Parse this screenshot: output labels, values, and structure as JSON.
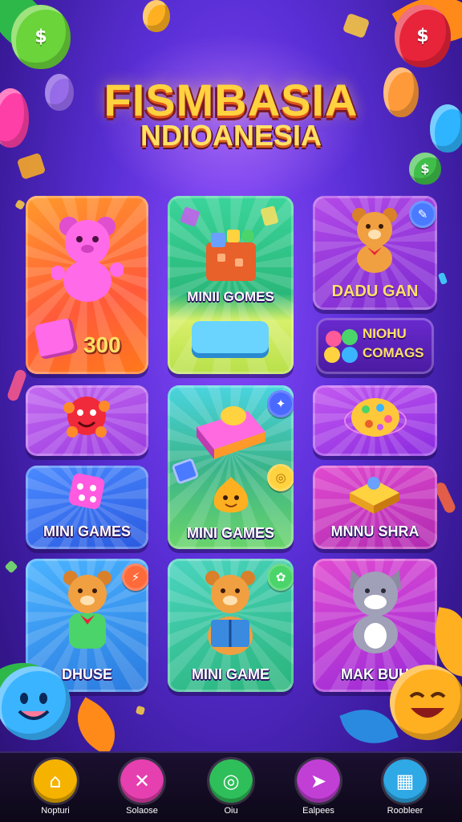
{
  "header": {
    "title_line1": "FISMBASIA",
    "title_line2": "NDIOANESIA"
  },
  "decor": {
    "balloon_left_glyph": "$",
    "balloon_right_glyph": "$",
    "balloon_small_glyph": "$"
  },
  "cards": {
    "bear_card": {
      "counter": "300",
      "icon": "pink-bear-icon"
    },
    "mini_box_card": {
      "label": "MINII GOMES",
      "icon": "gift-box-icon"
    },
    "dadu_card": {
      "label": "DADU GAN",
      "icon": "brown-bear-icon"
    },
    "combo_card": {
      "label_line1": "NIOHU",
      "label_line2": "COMAGS",
      "icon": "gem-cluster-icon"
    },
    "red_blob_card": {
      "icon": "red-blob-icon"
    },
    "big_green_card": {
      "label": "MINI GAMES",
      "icon": "cake-block-icon"
    },
    "cookie_card": {
      "icon": "cookie-icon"
    },
    "dice_card": {
      "label": "MINI GAMES",
      "icon": "dice-icon"
    },
    "gold_card": {
      "label": "MNNU SHRA",
      "icon": "gold-block-icon"
    },
    "bear_shirt_card": {
      "label": "DHUSE",
      "icon": "bear-shirt-icon"
    },
    "book_bear_card": {
      "label": "MINI GAME",
      "icon": "bear-book-icon"
    },
    "cat_card": {
      "label": "MAK BUH",
      "icon": "grey-cat-icon"
    }
  },
  "nav": {
    "items": [
      {
        "label": "Nopturi",
        "icon": "home-icon",
        "color": "#f5b300"
      },
      {
        "label": "Solaose",
        "icon": "puzzle-icon",
        "color": "#e63fb0"
      },
      {
        "label": "Oiu",
        "icon": "target-icon",
        "color": "#2fbf5a"
      },
      {
        "label": "Ealpees",
        "icon": "compass-icon",
        "color": "#c23fd6"
      },
      {
        "label": "Roobleer",
        "icon": "calendar-icon",
        "color": "#2fa8e6"
      }
    ]
  }
}
